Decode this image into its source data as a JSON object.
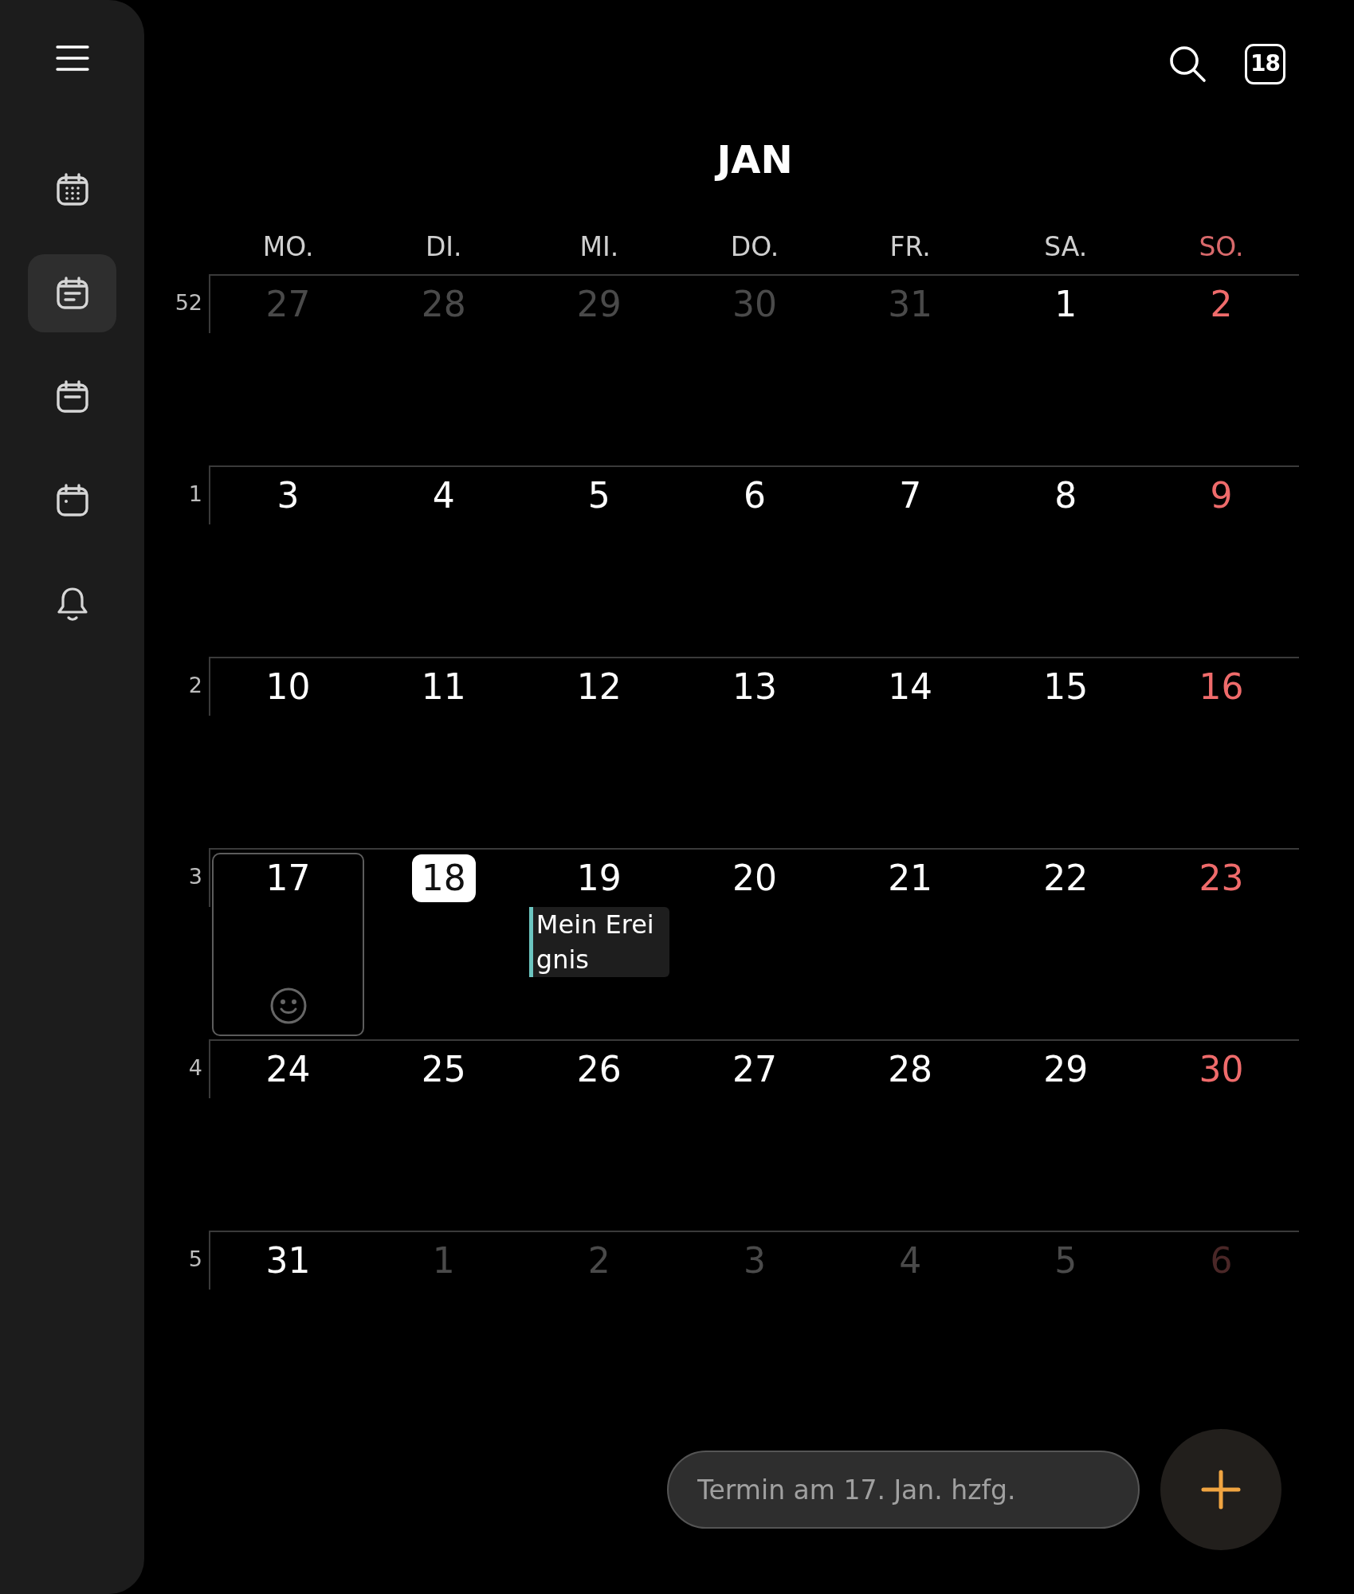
{
  "sidebar": {
    "items": [
      {
        "kind": "grid",
        "selected": false
      },
      {
        "kind": "lines",
        "selected": true
      },
      {
        "kind": "bar",
        "selected": false
      },
      {
        "kind": "dot",
        "selected": false
      },
      {
        "kind": "bell",
        "selected": false
      }
    ]
  },
  "toolbar": {
    "today_label": "18"
  },
  "month_title": "JAN",
  "weekdays": [
    {
      "label": "MO."
    },
    {
      "label": "DI."
    },
    {
      "label": "MI."
    },
    {
      "label": "DO."
    },
    {
      "label": "FR."
    },
    {
      "label": "SA."
    },
    {
      "label": "SO."
    }
  ],
  "weeks": [
    {
      "number": "52",
      "days": [
        {
          "label": "27",
          "other_month": true,
          "selected": false,
          "today": false
        },
        {
          "label": "28",
          "other_month": true,
          "selected": false,
          "today": false
        },
        {
          "label": "29",
          "other_month": true,
          "selected": false,
          "today": false
        },
        {
          "label": "30",
          "other_month": true,
          "selected": false,
          "today": false
        },
        {
          "label": "31",
          "other_month": true,
          "selected": false,
          "today": false
        },
        {
          "label": "1",
          "other_month": false,
          "selected": false,
          "today": false
        },
        {
          "label": "2",
          "other_month": false,
          "selected": false,
          "today": false
        }
      ]
    },
    {
      "number": "1",
      "days": [
        {
          "label": "3",
          "other_month": false,
          "selected": false,
          "today": false
        },
        {
          "label": "4",
          "other_month": false,
          "selected": false,
          "today": false
        },
        {
          "label": "5",
          "other_month": false,
          "selected": false,
          "today": false
        },
        {
          "label": "6",
          "other_month": false,
          "selected": false,
          "today": false
        },
        {
          "label": "7",
          "other_month": false,
          "selected": false,
          "today": false
        },
        {
          "label": "8",
          "other_month": false,
          "selected": false,
          "today": false
        },
        {
          "label": "9",
          "other_month": false,
          "selected": false,
          "today": false
        }
      ]
    },
    {
      "number": "2",
      "days": [
        {
          "label": "10",
          "other_month": false,
          "selected": false,
          "today": false
        },
        {
          "label": "11",
          "other_month": false,
          "selected": false,
          "today": false
        },
        {
          "label": "12",
          "other_month": false,
          "selected": false,
          "today": false
        },
        {
          "label": "13",
          "other_month": false,
          "selected": false,
          "today": false
        },
        {
          "label": "14",
          "other_month": false,
          "selected": false,
          "today": false
        },
        {
          "label": "15",
          "other_month": false,
          "selected": false,
          "today": false
        },
        {
          "label": "16",
          "other_month": false,
          "selected": false,
          "today": false
        }
      ]
    },
    {
      "number": "3",
      "days": [
        {
          "label": "17",
          "other_month": false,
          "selected": true,
          "today": false
        },
        {
          "label": "18",
          "other_month": false,
          "selected": false,
          "today": true
        },
        {
          "label": "19",
          "other_month": false,
          "selected": false,
          "today": false,
          "events": [
            {
              "title": "Mein Ereignis",
              "color": "#6cc5c0"
            }
          ]
        },
        {
          "label": "20",
          "other_month": false,
          "selected": false,
          "today": false
        },
        {
          "label": "21",
          "other_month": false,
          "selected": false,
          "today": false
        },
        {
          "label": "22",
          "other_month": false,
          "selected": false,
          "today": false
        },
        {
          "label": "23",
          "other_month": false,
          "selected": false,
          "today": false
        }
      ]
    },
    {
      "number": "4",
      "days": [
        {
          "label": "24",
          "other_month": false,
          "selected": false,
          "today": false
        },
        {
          "label": "25",
          "other_month": false,
          "selected": false,
          "today": false
        },
        {
          "label": "26",
          "other_month": false,
          "selected": false,
          "today": false
        },
        {
          "label": "27",
          "other_month": false,
          "selected": false,
          "today": false
        },
        {
          "label": "28",
          "other_month": false,
          "selected": false,
          "today": false
        },
        {
          "label": "29",
          "other_month": false,
          "selected": false,
          "today": false
        },
        {
          "label": "30",
          "other_month": false,
          "selected": false,
          "today": false
        }
      ]
    },
    {
      "number": "5",
      "days": [
        {
          "label": "31",
          "other_month": false,
          "selected": false,
          "today": false
        },
        {
          "label": "1",
          "other_month": true,
          "selected": false,
          "today": false
        },
        {
          "label": "2",
          "other_month": true,
          "selected": false,
          "today": false
        },
        {
          "label": "3",
          "other_month": true,
          "selected": false,
          "today": false
        },
        {
          "label": "4",
          "other_month": true,
          "selected": false,
          "today": false
        },
        {
          "label": "5",
          "other_month": true,
          "selected": false,
          "today": false
        },
        {
          "label": "6",
          "other_month": true,
          "selected": false,
          "today": false
        }
      ]
    }
  ],
  "quick_add": {
    "placeholder": "Termin am 17. Jan. hzfg."
  }
}
